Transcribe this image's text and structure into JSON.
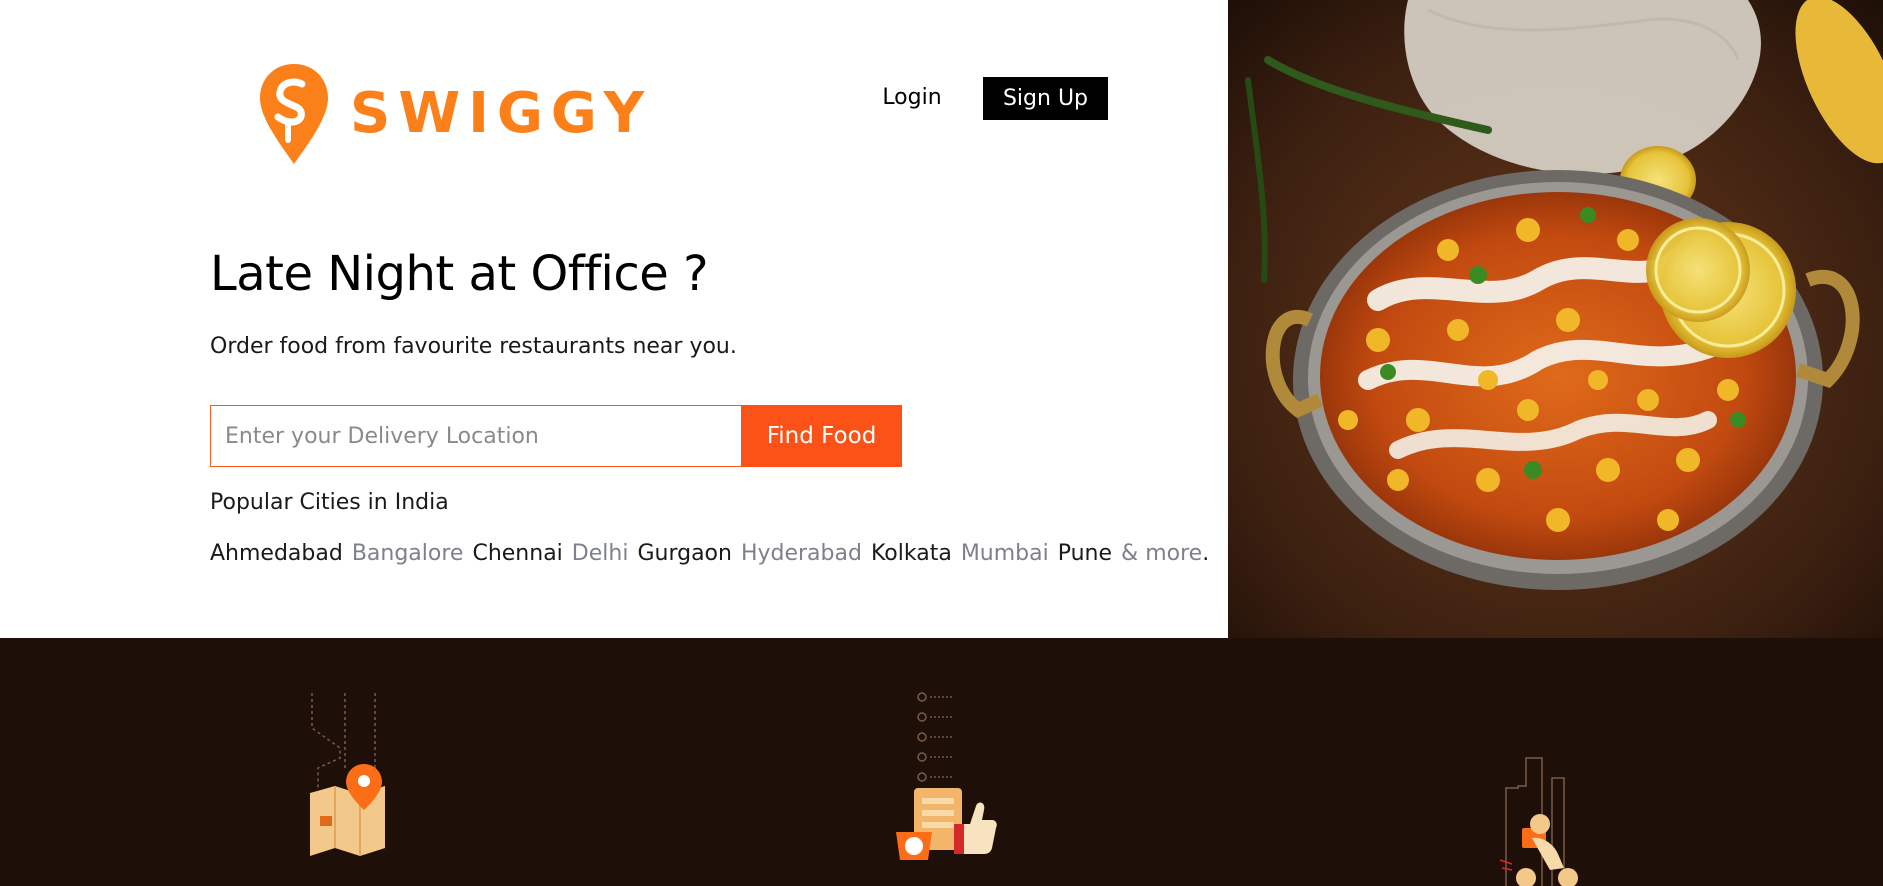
{
  "brand": {
    "name": "SWIGGY",
    "color": "#fc8019",
    "accent": "#fc5218"
  },
  "header": {
    "login_label": "Login",
    "signup_label": "Sign Up"
  },
  "hero": {
    "headline": "Late Night at Office ?",
    "subhead": "Order food from favourite restaurants near you."
  },
  "search": {
    "placeholder": "Enter your Delivery Location",
    "value": "",
    "button_label": "Find Food"
  },
  "popular": {
    "label": "Popular Cities in India",
    "cities": [
      {
        "name": "Ahmedabad",
        "tone": "dark"
      },
      {
        "name": "Bangalore",
        "tone": "light"
      },
      {
        "name": "Chennai",
        "tone": "dark"
      },
      {
        "name": "Delhi",
        "tone": "light"
      },
      {
        "name": "Gurgaon",
        "tone": "dark"
      },
      {
        "name": "Hyderabad",
        "tone": "light"
      },
      {
        "name": "Kolkata",
        "tone": "dark"
      },
      {
        "name": "Mumbai",
        "tone": "light"
      },
      {
        "name": "Pune",
        "tone": "dark"
      }
    ],
    "more_label": "& more",
    "end_punct": "."
  },
  "features": [
    {
      "icon": "map-location-icon"
    },
    {
      "icon": "order-thumbs-up-icon"
    },
    {
      "icon": "delivery-rider-icon"
    }
  ],
  "colors": {
    "footer_bg": "#1e1008",
    "city_light": "#7e808c"
  }
}
